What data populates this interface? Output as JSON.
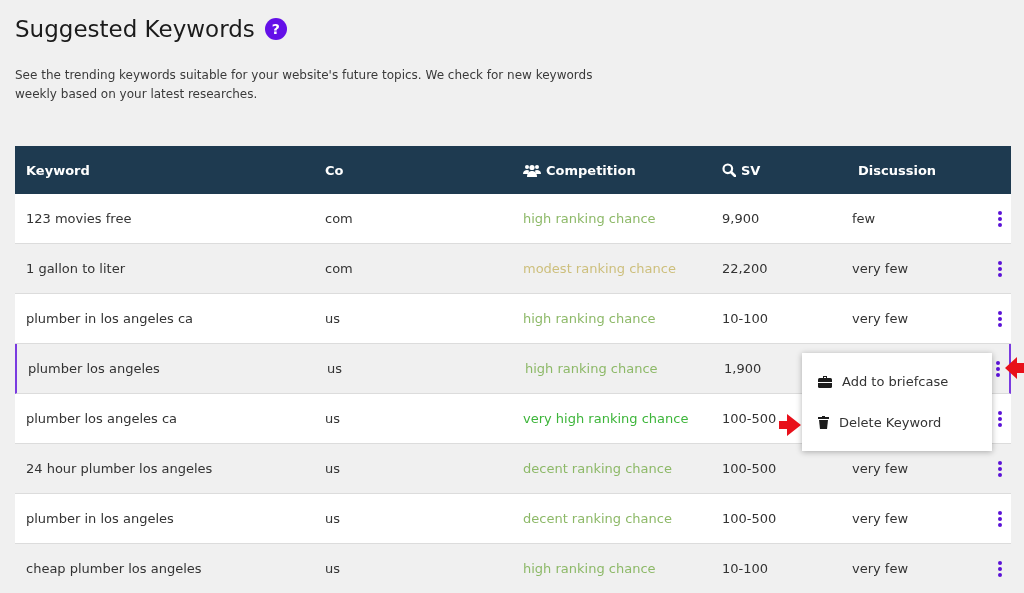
{
  "title": "Suggested Keywords",
  "help_badge": "?",
  "description": "See the trending keywords suitable for your website's future topics. We check for new keywords weekly based on your latest researches.",
  "table": {
    "columns": [
      "Keyword",
      "Co",
      "Competition",
      "SV",
      "Discussion"
    ],
    "rows": [
      {
        "keyword": "123 movies free",
        "co": "com",
        "competition": "high ranking chance",
        "color": "#8db968",
        "sv": "9,900",
        "discussion": "few",
        "selected": false
      },
      {
        "keyword": "1 gallon to liter",
        "co": "com",
        "competition": "modest ranking chance",
        "color": "#cdbf7c",
        "sv": "22,200",
        "discussion": "very few",
        "selected": false
      },
      {
        "keyword": "plumber in los angeles ca",
        "co": "us",
        "competition": "high ranking chance",
        "color": "#8db968",
        "sv": "10-100",
        "discussion": "very few",
        "selected": false
      },
      {
        "keyword": "plumber los angeles",
        "co": "us",
        "competition": "high ranking chance",
        "color": "#8db968",
        "sv": "1,900",
        "selected": true
      },
      {
        "keyword": "plumber los angeles ca",
        "co": "us",
        "competition": "very high ranking chance",
        "color": "#3db53a",
        "sv": "100-500",
        "selected": false
      },
      {
        "keyword": "24 hour plumber los angeles",
        "co": "us",
        "competition": "decent ranking chance",
        "color": "#8db968",
        "sv": "100-500",
        "discussion": "very few",
        "selected": false
      },
      {
        "keyword": "plumber in los angeles",
        "co": "us",
        "competition": "decent ranking chance",
        "color": "#8db968",
        "sv": "100-500",
        "discussion": "very few",
        "selected": false
      },
      {
        "keyword": "cheap plumber los angeles",
        "co": "us",
        "competition": "high ranking chance",
        "color": "#8db968",
        "sv": "10-100",
        "discussion": "very few",
        "selected": false
      }
    ]
  },
  "row_menu": {
    "items": [
      "Add to briefcase",
      "Delete Keyword"
    ]
  }
}
